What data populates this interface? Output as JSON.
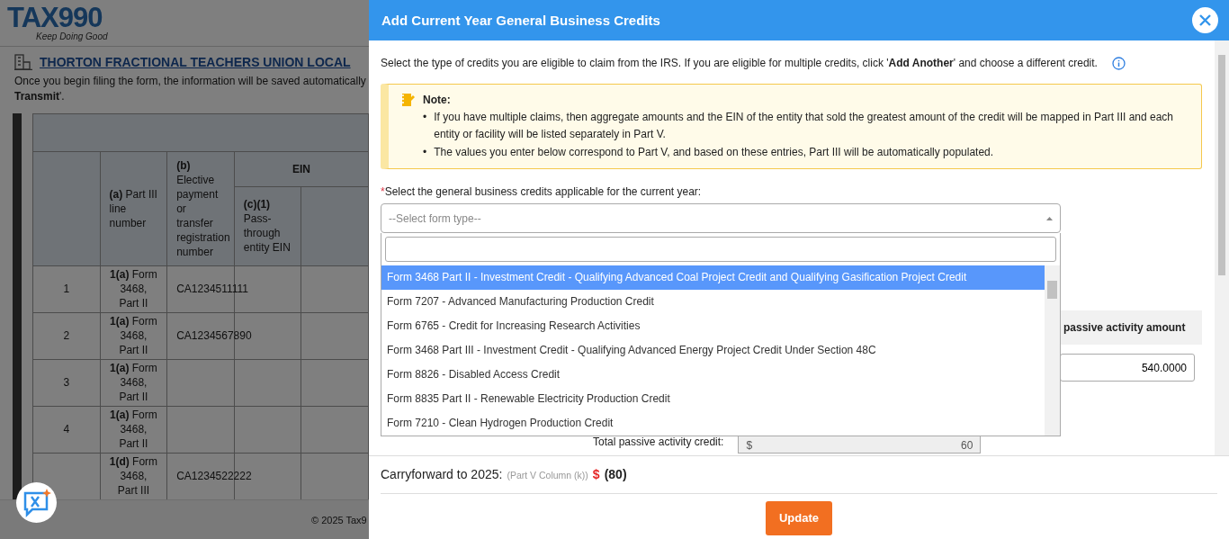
{
  "background_page": {
    "logo": {
      "name": "TAX990",
      "tagline": "Keep Doing Good"
    },
    "organization_title": "THORTON FRACTIONAL TEACHERS UNION LOCAL",
    "intro_lines": [
      "Once you begin filing the form, the information will be saved automatically",
      "**Transmit**'."
    ],
    "table": {
      "group_header": "EIN",
      "columns": [
        "**(a)** Part III line number",
        "**(b)** Elective payment or transfer registration number",
        "**(c)(1)** Pass-through entity EIN"
      ],
      "rows": [
        {
          "number": "1",
          "line": "**1(a)** Form 3468, Part II",
          "registration": "CA1234511111"
        },
        {
          "number": "2",
          "line": "**1(a)** Form 3468, Part II",
          "registration": "CA1234567890"
        },
        {
          "number": "3",
          "line": "**1(a)** Form 3468, Part II"
        },
        {
          "number": "4",
          "line": "**1(a)** Form 3468, Part II"
        },
        {
          "line": "**1(d)** Form 3468, Part III",
          "registration": "CA1234522222"
        }
      ]
    },
    "footer": "© 2025 Tax9"
  },
  "panel": {
    "title": "Add Current Year General Business Credits",
    "intro": "Select the type of credits you are eligible to claim from the IRS. If you are eligible for multiple credits, click '**Add Another**' and choose a different credit.",
    "note": {
      "title": "Note:",
      "marker": "•",
      "items": [
        "If you have multiple claims, then aggregate amounts and the EIN of the entity that sold the greatest amount of the credit will be mapped in Part III and each entity or facility will be listed separately in Part V.",
        "The values you enter below correspond to Part V, and based on these entries, Part III will be automatically populated."
      ]
    },
    "field": {
      "label": "Select the general business credits applicable for the current year:",
      "required_mark": "*",
      "placeholder": "--Select form type--",
      "expanded": true
    },
    "options": [
      {
        "label": "Form 3468 Part II - Investment Credit - Qualifying Advanced Coal Project Credit and Qualifying Gasification Project Credit",
        "selected": true
      },
      {
        "label": "Form 7207 - Advanced Manufacturing Production Credit",
        "selected": false
      },
      {
        "label": "Form 6765 - Credit for Increasing Research Activities",
        "selected": false
      },
      {
        "label": "Form 3468 Part III - Investment Credit - Qualifying Advanced Energy Project Credit Under Section 48C",
        "selected": false
      },
      {
        "label": "Form 8826 - Disabled Access Credit",
        "selected": false
      },
      {
        "label": "Form 8835 Part II - Renewable Electricity Production Credit",
        "selected": false
      },
      {
        "label": "Form 7210 - Clean Hydrogen Production Credit",
        "selected": false
      }
    ],
    "column_header": "passive activity amount",
    "amount": "540.0000",
    "total": {
      "label": "Total passive activity credit:",
      "prefix": "$",
      "value": "60"
    },
    "carryforward": {
      "label": "Carryforward to 2025:",
      "hint": "(Part V Column (k))",
      "currency": "$",
      "amount": "(80)"
    },
    "button": "Update"
  }
}
